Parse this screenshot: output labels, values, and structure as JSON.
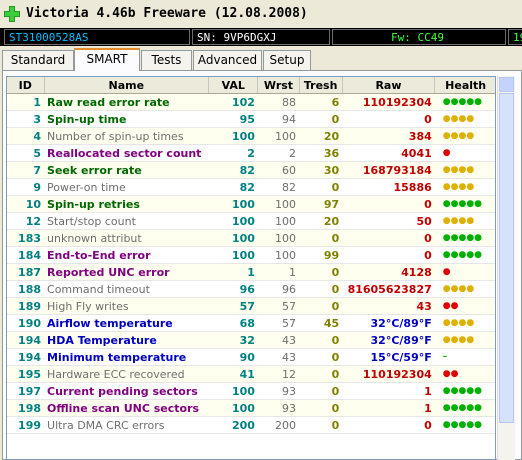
{
  "window": {
    "title": "Victoria 4.46b Freeware (12.08.2008)"
  },
  "drive": {
    "model": "ST31000528AS",
    "serial": "SN: 9VP6DGXJ",
    "firmware": "Fw: CC49",
    "extra": "19"
  },
  "tabs": [
    "Standard",
    "SMART",
    "Tests",
    "Advanced",
    "Setup"
  ],
  "active_tab": "SMART",
  "columns": [
    "ID",
    "Name",
    "VAL",
    "Wrst",
    "Tresh",
    "Raw",
    "Health"
  ],
  "rows": [
    {
      "id": "1",
      "name": "Raw read error rate",
      "val": "102",
      "wrst": "88",
      "tresh": "6",
      "raw": "110192304",
      "health": "●●●●●",
      "hc": "green",
      "nc": "green"
    },
    {
      "id": "3",
      "name": "Spin-up time",
      "val": "95",
      "wrst": "94",
      "tresh": "0",
      "raw": "0",
      "health": "●●●●",
      "hc": "yellow",
      "nc": "green"
    },
    {
      "id": "4",
      "name": "Number of spin-up times",
      "val": "100",
      "wrst": "100",
      "tresh": "20",
      "raw": "384",
      "health": "●●●●",
      "hc": "yellow",
      "nc": "grey"
    },
    {
      "id": "5",
      "name": "Reallocated sector count",
      "val": "2",
      "wrst": "2",
      "tresh": "36",
      "raw": "4041",
      "health": "●",
      "hc": "red",
      "nc": "purple"
    },
    {
      "id": "7",
      "name": "Seek error rate",
      "val": "82",
      "wrst": "60",
      "tresh": "30",
      "raw": "168793184",
      "health": "●●●●",
      "hc": "yellow",
      "nc": "green"
    },
    {
      "id": "9",
      "name": "Power-on time",
      "val": "82",
      "wrst": "82",
      "tresh": "0",
      "raw": "15886",
      "health": "●●●●",
      "hc": "yellow",
      "nc": "grey"
    },
    {
      "id": "10",
      "name": "Spin-up retries",
      "val": "100",
      "wrst": "100",
      "tresh": "97",
      "raw": "0",
      "health": "●●●●●",
      "hc": "green",
      "nc": "green"
    },
    {
      "id": "12",
      "name": "Start/stop count",
      "val": "100",
      "wrst": "100",
      "tresh": "20",
      "raw": "50",
      "health": "●●●●",
      "hc": "yellow",
      "nc": "grey"
    },
    {
      "id": "183",
      "name": "unknown attribut",
      "val": "100",
      "wrst": "100",
      "tresh": "0",
      "raw": "0",
      "health": "●●●●●",
      "hc": "green",
      "nc": "grey"
    },
    {
      "id": "184",
      "name": "End-to-End error",
      "val": "100",
      "wrst": "100",
      "tresh": "99",
      "raw": "0",
      "health": "●●●●●",
      "hc": "green",
      "nc": "purple"
    },
    {
      "id": "187",
      "name": "Reported UNC error",
      "val": "1",
      "wrst": "1",
      "tresh": "0",
      "raw": "4128",
      "health": "●",
      "hc": "red",
      "nc": "purple"
    },
    {
      "id": "188",
      "name": "Command timeout",
      "val": "96",
      "wrst": "96",
      "tresh": "0",
      "raw": "81605623827",
      "health": "●●●●",
      "hc": "yellow",
      "nc": "grey"
    },
    {
      "id": "189",
      "name": "High Fly writes",
      "val": "57",
      "wrst": "57",
      "tresh": "0",
      "raw": "43",
      "health": "●●",
      "hc": "red",
      "nc": "grey"
    },
    {
      "id": "190",
      "name": "Airflow temperature",
      "val": "68",
      "wrst": "57",
      "tresh": "45",
      "raw": "32°C/89°F",
      "health": "●●●●",
      "hc": "yellow",
      "nc": "blue"
    },
    {
      "id": "194",
      "name": "HDA Temperature",
      "val": "32",
      "wrst": "43",
      "tresh": "0",
      "raw": "32°C/89°F",
      "health": "●●●●",
      "hc": "yellow",
      "nc": "blue"
    },
    {
      "id": "194",
      "name": "Minimum temperature",
      "val": "90",
      "wrst": "43",
      "tresh": "0",
      "raw": "15°C/59°F",
      "health": "–",
      "hc": "green",
      "nc": "blue"
    },
    {
      "id": "195",
      "name": "Hardware ECC recovered",
      "val": "41",
      "wrst": "12",
      "tresh": "0",
      "raw": "110192304",
      "health": "●●",
      "hc": "red",
      "nc": "grey"
    },
    {
      "id": "197",
      "name": "Current pending sectors",
      "val": "100",
      "wrst": "93",
      "tresh": "0",
      "raw": "1",
      "health": "●●●●●",
      "hc": "green",
      "nc": "purple"
    },
    {
      "id": "198",
      "name": "Offline scan UNC sectors",
      "val": "100",
      "wrst": "93",
      "tresh": "0",
      "raw": "1",
      "health": "●●●●●",
      "hc": "green",
      "nc": "purple"
    },
    {
      "id": "199",
      "name": "Ultra DMA CRC errors",
      "val": "200",
      "wrst": "200",
      "tresh": "0",
      "raw": "0",
      "health": "●●●●●",
      "hc": "green",
      "nc": "grey"
    }
  ],
  "colors": {
    "accent_tab": "#e68b2c",
    "info_bg": "#000000",
    "serial_color": "#ffffff",
    "model_color": "#00c0ff",
    "fw_color": "#40ff40"
  }
}
